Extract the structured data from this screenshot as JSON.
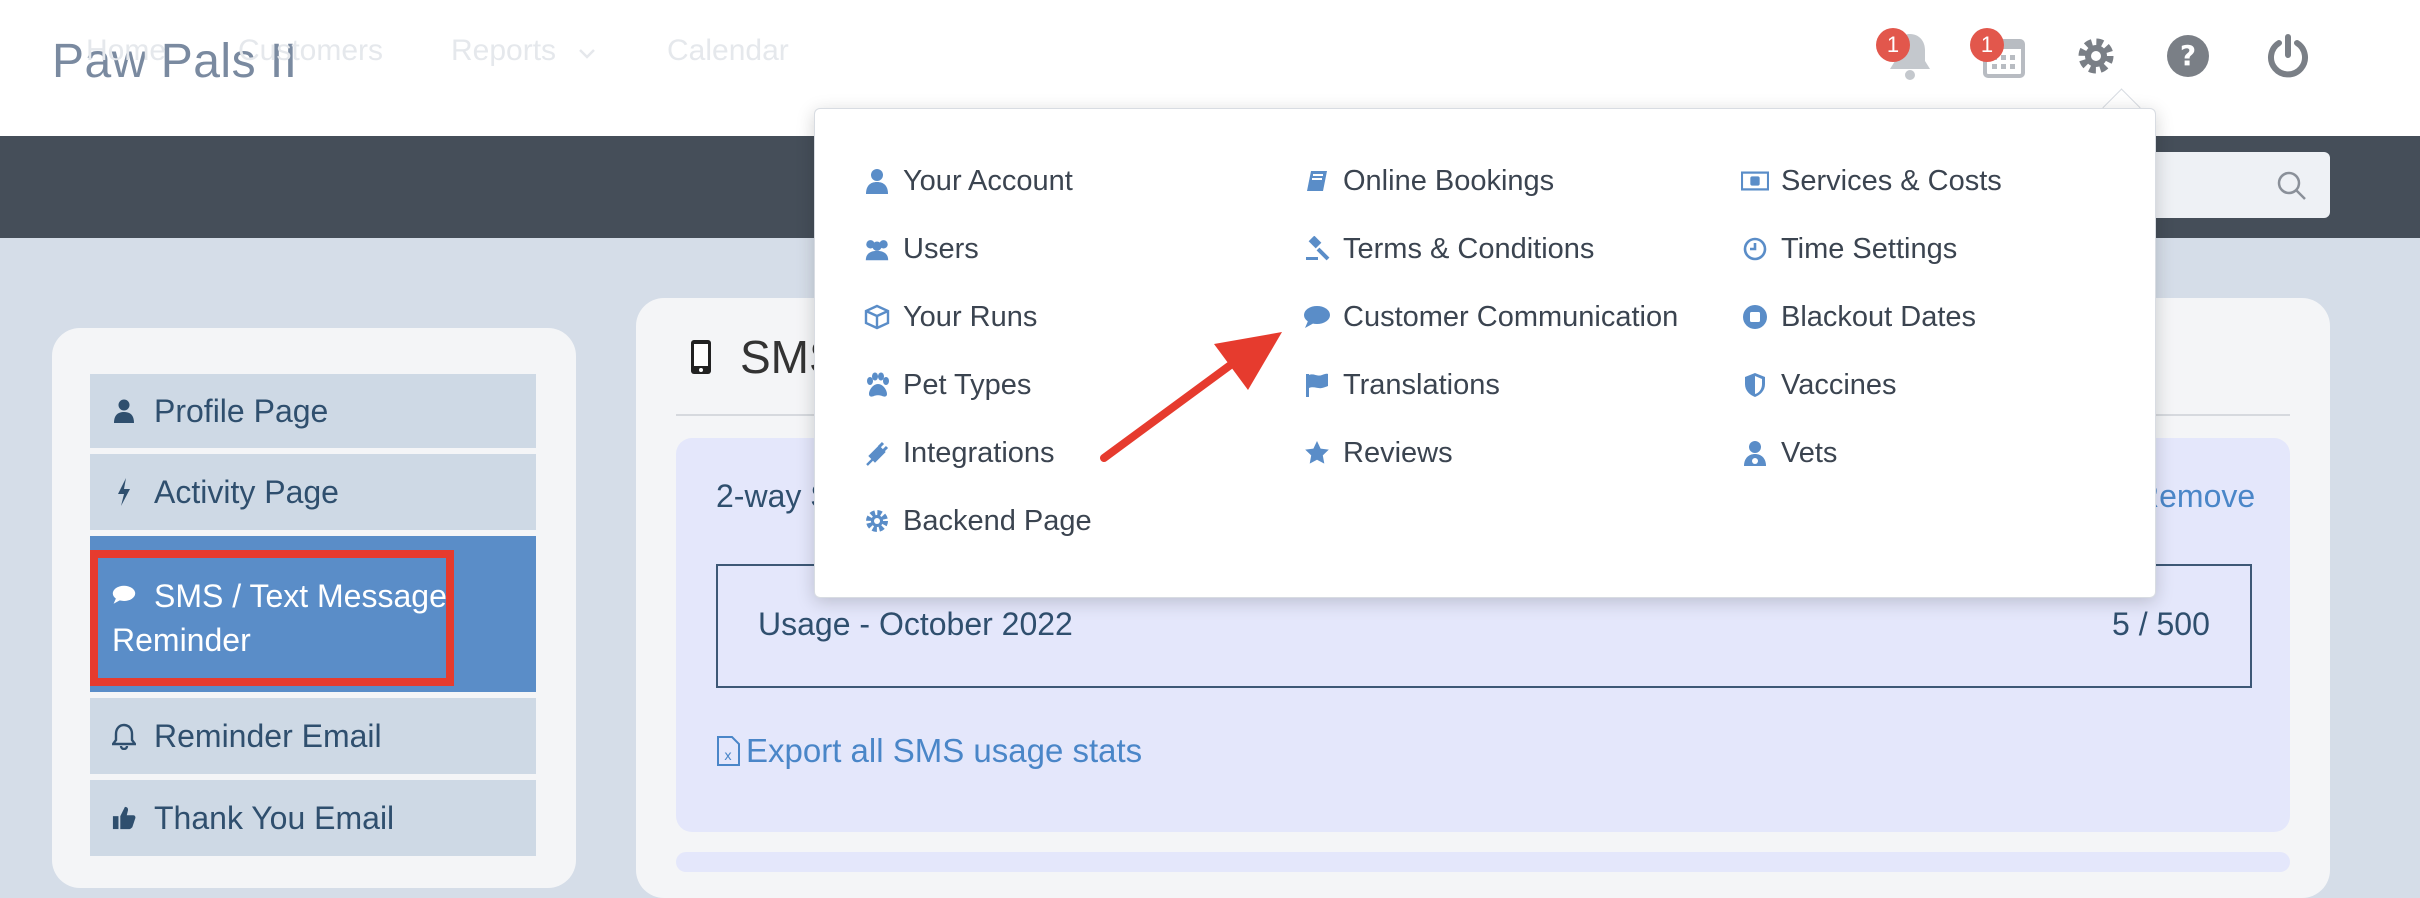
{
  "app": {
    "title": "Paw Pals II"
  },
  "header": {
    "notifications_badge": "1",
    "calendar_badge": "1"
  },
  "nav": {
    "items": [
      {
        "label": "Home"
      },
      {
        "label": "Customers"
      },
      {
        "label": "Reports"
      },
      {
        "label": "Calendar"
      }
    ]
  },
  "sidebar": {
    "items": [
      {
        "label": "Profile Page",
        "icon": "user-icon"
      },
      {
        "label": "Activity Page",
        "icon": "bolt-icon"
      },
      {
        "label": "SMS / Text Message Reminder",
        "line1": "SMS / Text Message",
        "line2": "Reminder",
        "icon": "comment-icon",
        "active": true
      },
      {
        "label": "Reminder Email",
        "icon": "bell-icon"
      },
      {
        "label": "Thank You Email",
        "icon": "thumbs-up-icon"
      }
    ]
  },
  "main": {
    "title": "SMS",
    "twoway_label": "2-way S",
    "remove_label": "Remove",
    "usage_label": "Usage - October 2022",
    "usage_value": "5 / 500",
    "export_label": "Export all SMS usage stats"
  },
  "dropdown": {
    "col1": [
      {
        "label": "Your Account",
        "icon": "user-icon"
      },
      {
        "label": "Users",
        "icon": "users-icon"
      },
      {
        "label": "Your Runs",
        "icon": "cube-icon"
      },
      {
        "label": "Pet Types",
        "icon": "paw-icon"
      },
      {
        "label": "Integrations",
        "icon": "plug-icon"
      },
      {
        "label": "Backend Page",
        "icon": "gear-icon"
      }
    ],
    "col2": [
      {
        "label": "Online Bookings",
        "icon": "book-icon"
      },
      {
        "label": "Terms & Conditions",
        "icon": "gavel-icon"
      },
      {
        "label": "Customer Communication",
        "icon": "comment-icon"
      },
      {
        "label": "Translations",
        "icon": "flag-icon"
      },
      {
        "label": "Reviews",
        "icon": "star-icon"
      }
    ],
    "col3": [
      {
        "label": "Services & Costs",
        "icon": "money-icon"
      },
      {
        "label": "Time Settings",
        "icon": "clock-icon"
      },
      {
        "label": "Blackout Dates",
        "icon": "stop-icon"
      },
      {
        "label": "Vaccines",
        "icon": "shield-icon"
      },
      {
        "label": "Vets",
        "icon": "doctor-icon"
      }
    ]
  },
  "colors": {
    "accent": "#5a8dc8",
    "nav_bg": "#454e59",
    "highlight": "#e63b2e",
    "badge": "#e2574c"
  }
}
